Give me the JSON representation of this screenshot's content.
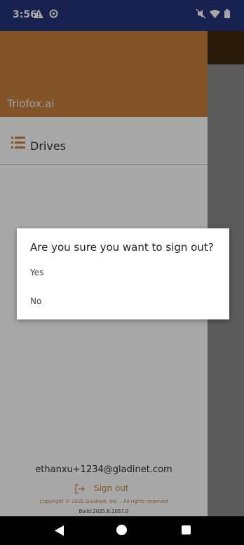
{
  "status_bar": {
    "time": "3:56",
    "left_icons": [
      "warning-icon",
      "settings-icon"
    ],
    "right_icons": [
      "mute-icon",
      "wifi-icon",
      "battery-icon"
    ],
    "color": "#25347a"
  },
  "drawer": {
    "header_title": "Triofox.ai",
    "header_color": "#c5803e",
    "items": [
      {
        "label": "Drives",
        "icon": "menu-list-icon"
      }
    ],
    "footer": {
      "email": "ethanxu+1234@gladinet.com",
      "signout_label": "Sign out",
      "signout_icon": "logout-icon",
      "copyright": "Copyright © 2025 Gladinet, Inc. - All rights reserved",
      "build": "Build 2025.6.1057.0"
    }
  },
  "dialog": {
    "title": "Are you sure you want to sign out?",
    "options": [
      "Yes",
      "No"
    ]
  },
  "nav_bar": {
    "buttons": [
      "back-icon",
      "home-icon",
      "recents-icon"
    ]
  }
}
